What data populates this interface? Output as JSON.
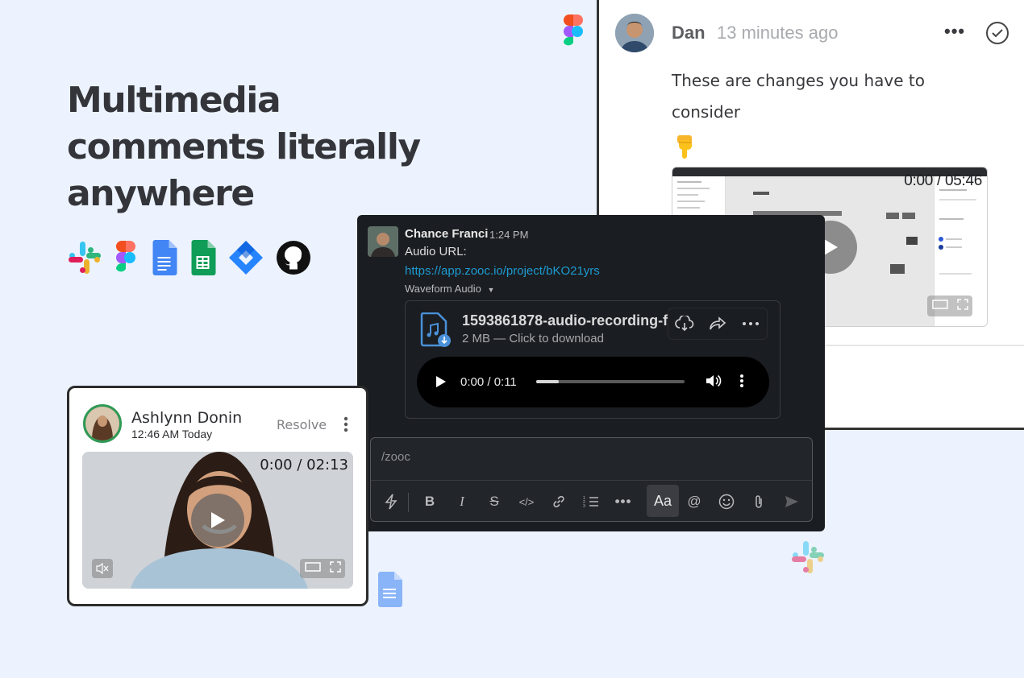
{
  "hero": {
    "title_lines": [
      "Multimedia",
      "comments literally",
      "anywhere"
    ]
  },
  "app_icons": [
    "slack-icon",
    "figma-icon",
    "google-docs-icon",
    "google-sheets-icon",
    "jira-icon",
    "github-icon"
  ],
  "dan_comment": {
    "author": "Dan",
    "time": "13 minutes ago",
    "more_label": "•••",
    "text_lines": [
      "These are changes you have to",
      "consider"
    ],
    "emoji": "point-down-emoji",
    "video": {
      "time": "0:00 / 05:46"
    }
  },
  "slack_message": {
    "author": "Chance Franci",
    "time": "1:24 PM",
    "label": "Audio URL:",
    "link": "https://app.zooc.io/project/bKO21yrs",
    "attachment_label": "Waveform Audio",
    "file": {
      "name": "1593861878-audio-recording-f",
      "size": "2 MB — Click to download"
    },
    "player": {
      "time": "0:00 / 0:11",
      "progress": 0.15
    },
    "composer": {
      "text": "/zooc",
      "format_button": "Aa"
    }
  },
  "ashlynn_comment": {
    "author": "Ashlynn Donin",
    "time": "12:46 AM Today",
    "resolve_label": "Resolve",
    "video": {
      "time": "0:00 / 02:13"
    }
  },
  "colors": {
    "background": "#ecf3fe",
    "slack_panel": "#1a1d21",
    "link": "#1d9bd1",
    "avatar_ring": "#2e9a55"
  }
}
